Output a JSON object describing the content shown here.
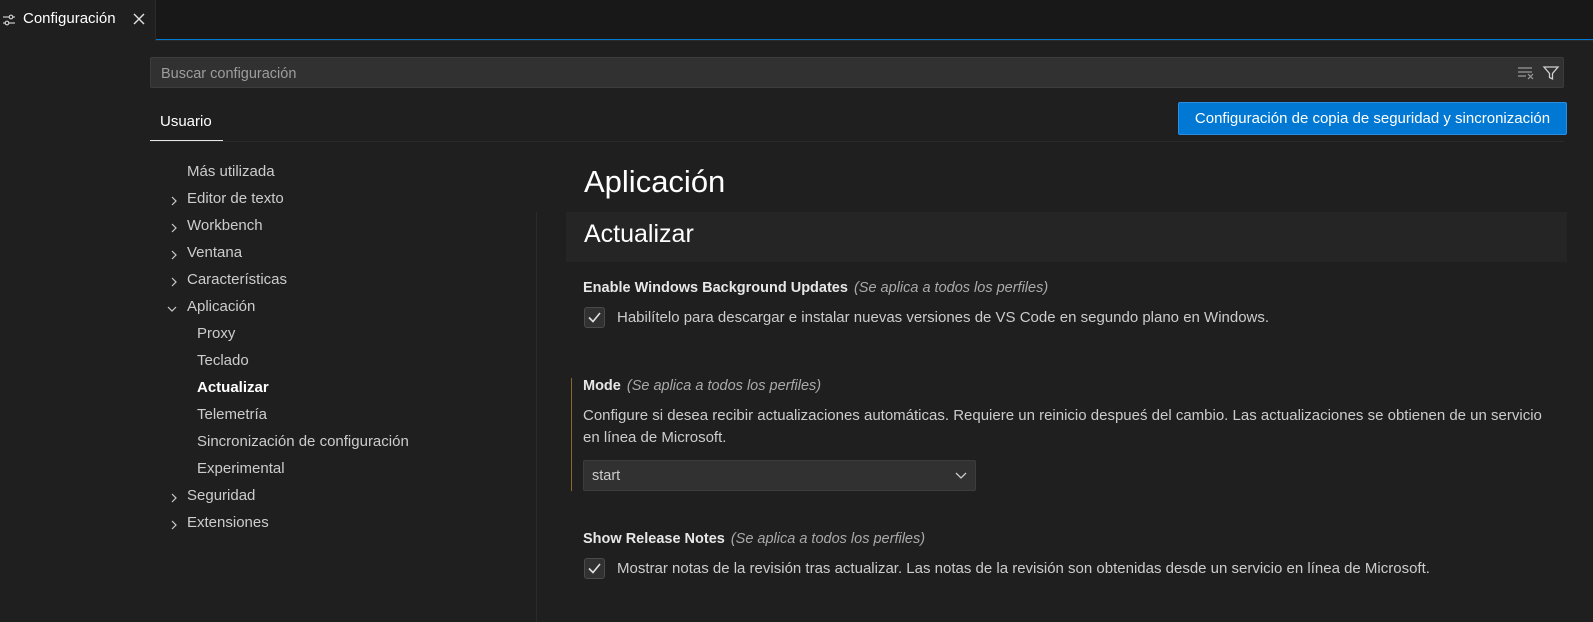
{
  "tab": {
    "title": "Configuración"
  },
  "search": {
    "placeholder": "Buscar configuración",
    "value": ""
  },
  "scope_tabs": [
    {
      "label": "Usuario",
      "active": true
    }
  ],
  "sync_button": {
    "label": "Configuración de copia de seguridad y sincronización"
  },
  "toc": {
    "items": [
      {
        "label": "Más utilizada",
        "expandable": false
      },
      {
        "label": "Editor de texto",
        "expandable": true,
        "expanded": false
      },
      {
        "label": "Workbench",
        "expandable": true,
        "expanded": false
      },
      {
        "label": "Ventana",
        "expandable": true,
        "expanded": false
      },
      {
        "label": "Características",
        "expandable": true,
        "expanded": false
      },
      {
        "label": "Aplicación",
        "expandable": true,
        "expanded": true
      },
      {
        "label": "Proxy",
        "child": true
      },
      {
        "label": "Teclado",
        "child": true
      },
      {
        "label": "Actualizar",
        "child": true,
        "active": true
      },
      {
        "label": "Telemetría",
        "child": true
      },
      {
        "label": "Sincronización de configuración",
        "child": true
      },
      {
        "label": "Experimental",
        "child": true
      },
      {
        "label": "Seguridad",
        "expandable": true,
        "expanded": false
      },
      {
        "label": "Extensiones",
        "expandable": true,
        "expanded": false
      }
    ]
  },
  "content": {
    "section_title": "Aplicación",
    "subsection_title": "Actualizar",
    "settings": [
      {
        "title": "Enable Windows Background Updates",
        "scope_note": "(Se aplica a todos los perfiles)",
        "type": "checkbox",
        "checked": true,
        "description": "Habilítelo para descargar e instalar nuevas versiones de VS Code en segundo plano en Windows."
      },
      {
        "title": "Mode",
        "scope_note": "(Se aplica a todos los perfiles)",
        "type": "select",
        "description": "Configure si desea recibir actualizaciones automáticas. Requiere un reinicio despueś del cambio. Las actualizaciones se obtienen de un servicio en línea de Microsoft.",
        "value": "start"
      },
      {
        "title": "Show Release Notes",
        "scope_note": "(Se aplica a todos los perfiles)",
        "type": "checkbox",
        "checked": true,
        "description": "Mostrar notas de la revisión tras actualizar. Las notas de la revisión son obtenidas desde un servicio en línea de Microsoft."
      }
    ]
  },
  "colors": {
    "accent": "#0078d4",
    "background": "#1f1f1f",
    "modified_indicator": "#8a6a2a"
  }
}
